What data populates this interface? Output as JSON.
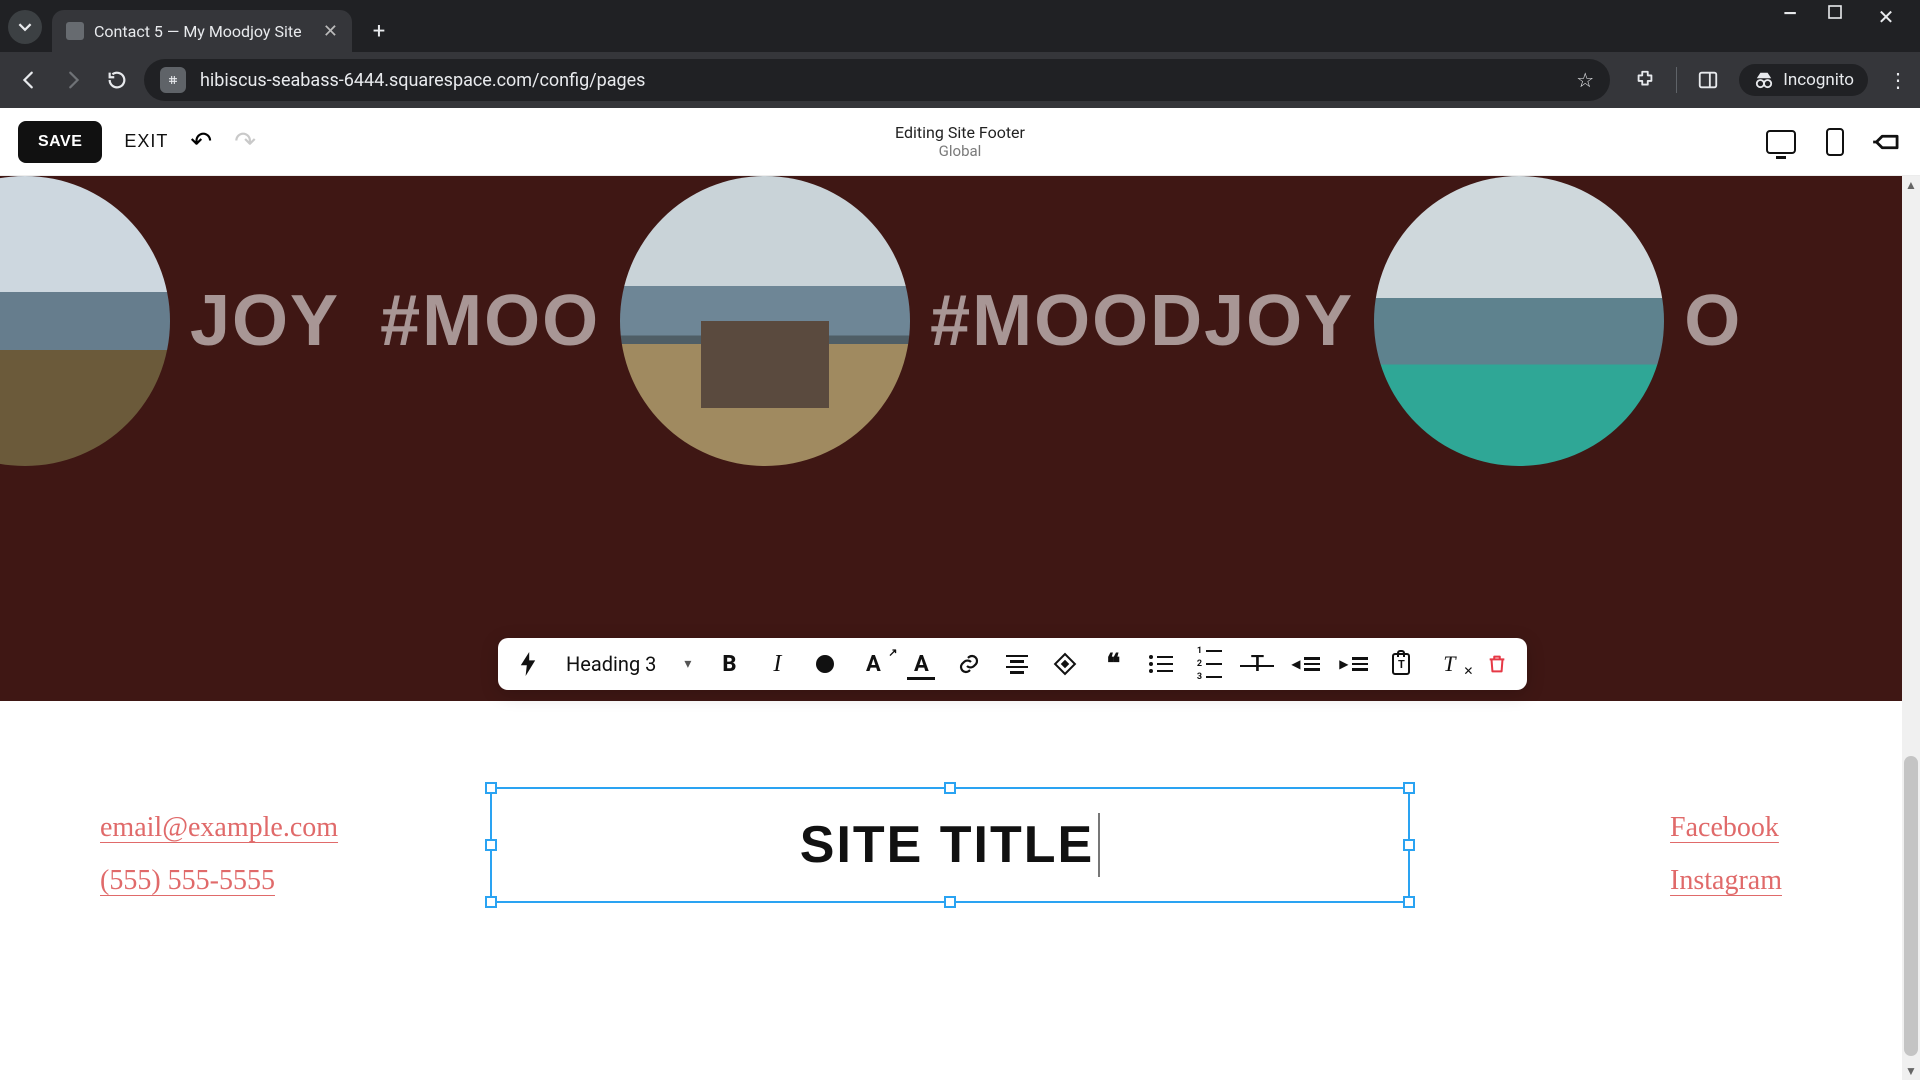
{
  "browser": {
    "tab_title": "Contact 5 — My Moodjoy Site",
    "url": "hibiscus-seabass-6444.squarespace.com/config/pages",
    "incognito_label": "Incognito"
  },
  "editor_bar": {
    "save": "SAVE",
    "exit": "EXIT",
    "context_title": "Editing Site Footer",
    "context_scope": "Global"
  },
  "text_toolbar": {
    "style_label": "Heading 3"
  },
  "marquee": {
    "fragments": [
      "JOY",
      "#MOO",
      "#MOODJOY",
      "O"
    ]
  },
  "footer": {
    "contact": {
      "email": "email@example.com",
      "phone": "(555) 555-5555"
    },
    "site_title": "SITE TITLE",
    "social": {
      "facebook": "Facebook",
      "instagram": "Instagram"
    }
  }
}
